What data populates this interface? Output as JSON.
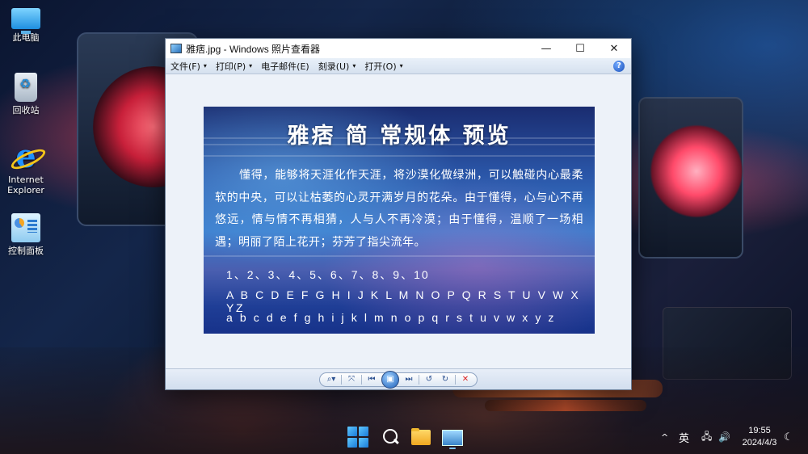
{
  "desktop": {
    "icons": [
      {
        "label": "此电脑",
        "icon": "computer-icon"
      },
      {
        "label": "回收站",
        "icon": "recycle-bin-icon"
      },
      {
        "label": "Internet Explorer",
        "icon": "internet-explorer-icon"
      },
      {
        "label": "控制面板",
        "icon": "control-panel-icon"
      }
    ]
  },
  "window": {
    "title": "雅痞.jpg - Windows 照片查看器",
    "controls": {
      "minimize": "—",
      "maximize": "☐",
      "close": "✕"
    },
    "menu": [
      {
        "label": "文件(F)",
        "caret": "▾"
      },
      {
        "label": "打印(P)",
        "caret": "▾"
      },
      {
        "label": "电子邮件(E)",
        "caret": ""
      },
      {
        "label": "刻录(U)",
        "caret": "▾"
      },
      {
        "label": "打开(O)",
        "caret": "▾"
      }
    ],
    "help": "?"
  },
  "photo": {
    "title": "雅痞 简 常规体 预览",
    "paragraph": "懂得，能够将天涯化作天涯，将沙漠化做绿洲，可以触碰内心最柔软的中央，可以让枯萎的心灵开满岁月的花朵。由于懂得，心与心不再悠远，情与情不再相猜，人与人不再冷漠；由于懂得，温顺了一场相遇；明丽了陌上花开；芬芳了指尖流年。",
    "digits": "1、2、3、4、5、6、7、8、9、10",
    "uppercase": "A B C D E F G H I J K L M N O P Q R S T U V W X YZ",
    "lowercase": "a b c d e f g h i j k l m n o p q r s t u v w x y z"
  },
  "toolbar": {
    "zoom": "⌕▾",
    "fit": "⤧",
    "prev": "⏮",
    "slideshow": "▣",
    "next": "⏭",
    "rotate_ccw": "↺",
    "rotate_cw": "↻",
    "delete": "✕"
  },
  "taskbar": {
    "tray": {
      "chevron": "^",
      "ime": "英",
      "network": "🖧",
      "volume": "🔊",
      "night": "☾"
    },
    "clock": {
      "time": "19:55",
      "date": "2024/4/3"
    }
  }
}
